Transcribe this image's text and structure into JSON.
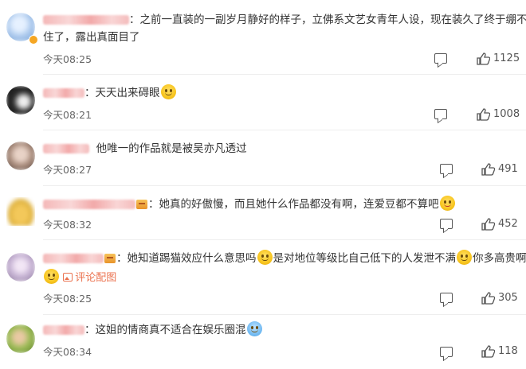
{
  "comments": [
    {
      "segments": [
        {
          "t": "text",
          "v": "之前一直装的一副岁月静好的样子，立佛系文艺女青年人设，现在装久了终于绷不"
        }
      ],
      "line2": "住了，露出真面目了",
      "time": "今天08:25",
      "likes": "1125",
      "avatar_color": "#a9c7ec"
    },
    {
      "prefix": "：",
      "text": "天天出来碍眼",
      "emoji": "smile-emoji",
      "time": "今天08:21",
      "likes": "1008",
      "avatar_color": "#2b2b2b"
    },
    {
      "text": "他唯一的作品就是被吴亦凡透过",
      "time": "今天08:27",
      "likes": "491",
      "avatar_color": "#a78a7a"
    },
    {
      "prefix": "：",
      "text": "她真的好傲慢，而且她什么作品都没有啊，连爱豆都不算吧",
      "emoji": "tongue-emoji",
      "time": "今天08:32",
      "likes": "452",
      "avatar_color": "#e0b340"
    },
    {
      "prefix": "：",
      "text_a": "她知道踢猫效应什么意思吗",
      "text_b": "是对地位等级比自己低下的人发泄不满",
      "text_c": "你多高贵啊",
      "pic_link": "评论配图",
      "time": "今天08:25",
      "likes": "305",
      "avatar_color": "#c9b6d6"
    },
    {
      "prefix": "：",
      "text": "这姐的情商真不适合在娱乐圈混",
      "emoji": "laugh-emoji",
      "time": "今天08:34",
      "likes": "118",
      "avatar_color": "#9bbb55"
    }
  ]
}
